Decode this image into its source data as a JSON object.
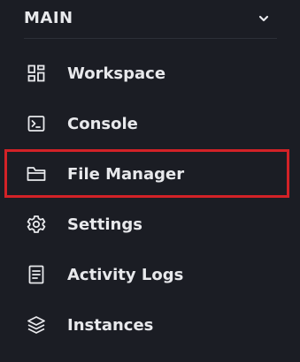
{
  "sidebar": {
    "section_title": "MAIN",
    "items": [
      {
        "label": "Workspace",
        "icon": "grid-icon"
      },
      {
        "label": "Console",
        "icon": "terminal-icon"
      },
      {
        "label": "File Manager",
        "icon": "folder-icon"
      },
      {
        "label": "Settings",
        "icon": "gear-icon"
      },
      {
        "label": "Activity Logs",
        "icon": "document-icon"
      },
      {
        "label": "Instances",
        "icon": "layers-icon"
      }
    ]
  },
  "colors": {
    "background": "#1b1d24",
    "text": "#e8e9ec",
    "highlight_border": "#d32227"
  }
}
